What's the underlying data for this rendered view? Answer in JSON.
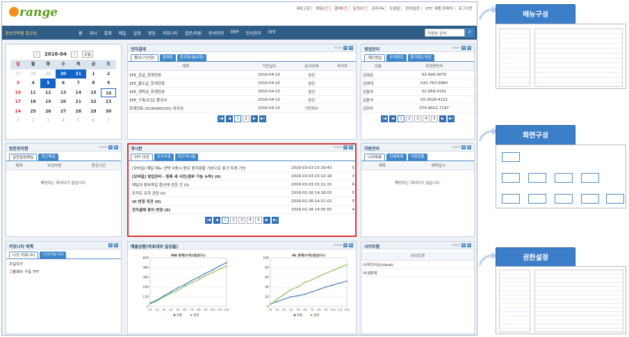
{
  "logo": {
    "text": "range"
  },
  "top_links": [
    {
      "label": "새로고침",
      "badge": ""
    },
    {
      "label": "메일",
      "badge": "0건"
    },
    {
      "label": "결재",
      "badge": "0건"
    },
    {
      "label": "일정",
      "badge": "0건"
    },
    {
      "label": "관리자▾",
      "badge": ""
    },
    {
      "label": "도움말",
      "badge": ""
    },
    {
      "label": "환경설정",
      "badge": ""
    },
    {
      "label": "OTC 제품 판매처",
      "badge": ""
    },
    {
      "label": "로그아웃",
      "badge": ""
    }
  ],
  "nav": {
    "user": "경보전략팀  정규성",
    "items": [
      "홈",
      "게시",
      "결재",
      "메일",
      "일정",
      "영업",
      "커뮤니티",
      "설문/자원",
      "문서관리",
      "ERP",
      "인사관리",
      "SFE"
    ],
    "search_placeholder": "직원명 검색"
  },
  "calendar": {
    "month": "2016-04",
    "today_label": "오늘",
    "days": [
      "일",
      "월",
      "화",
      "수",
      "목",
      "금",
      "토"
    ],
    "rows": [
      [
        "27",
        "28",
        "29",
        "30",
        "31",
        "1",
        "2"
      ],
      [
        "3",
        "4",
        "5",
        "6",
        "7",
        "8",
        "9"
      ],
      [
        "10",
        "11",
        "12",
        "13",
        "14",
        "15",
        "16"
      ],
      [
        "17",
        "18",
        "19",
        "20",
        "21",
        "22",
        "23"
      ],
      [
        "24",
        "25",
        "26",
        "27",
        "28",
        "29",
        "30"
      ],
      [
        "1",
        "2",
        "3",
        "4",
        "5",
        "6",
        "7"
      ]
    ]
  },
  "approval": {
    "title": "전자결재",
    "more": "more",
    "tabs": [
      "품의(기안함)",
      "결재함",
      "참조함(통보함)"
    ],
    "columns": [
      "제목",
      "기안일자",
      "문서상태",
      "처리자"
    ],
    "rows": [
      [
        "SFE_관급_회계전표",
        "2016-04-15",
        "승인",
        ""
      ],
      [
        "SFE_총도급_회계전표",
        "2016-04-15",
        "승인",
        ""
      ],
      [
        "SFE_계약금_회계전표",
        "2016-04-15",
        "승인",
        ""
      ],
      [
        "SFE_구축(도입) 품의서",
        "2016-04-15",
        "승인",
        ""
      ],
      [
        "회계전표-20160401001-정규성",
        "2016-04-15",
        "기안회수",
        ""
      ]
    ],
    "pages": [
      "1",
      "2"
    ]
  },
  "sales": {
    "title": "영업관리",
    "more": "more",
    "tabs": [
      "개인영업",
      "공개영업",
      "즐겨찾는영업"
    ],
    "columns": [
      "이름",
      "주연연락처"
    ],
    "rows": [
      [
        "김영준",
        "02-420-0075"
      ],
      [
        "김영대",
        "031-763-5860"
      ],
      [
        "김향국",
        "02-959-0161"
      ],
      [
        "김윤석",
        "02-2626-4131"
      ],
      [
        "김현아",
        "070-4012-7197"
      ]
    ],
    "pages": [
      "1",
      "2",
      "3",
      "4",
      "5"
    ]
  },
  "visit": {
    "title": "방문관리함",
    "more": "more",
    "tabs": [
      "일정알림메일",
      "최근메일"
    ],
    "columns": [
      "제목",
      "보낸사람",
      "받은시간"
    ],
    "empty": "해당하는 데이터가 없습니다."
  },
  "board": {
    "title": "게시판",
    "more": "more",
    "tabs": [
      "TFT 의견",
      "공지사항",
      "최근게시물"
    ],
    "rows": [
      [
        "[모바일] 메일 메뉴 선택 이동시 받은 편지함을 기본으로 표기 되게 가능",
        "2016-03-03 15:19:43",
        "5"
      ],
      [
        "[모바일] 영업관리 - 등록 세 사전(첨부 기능 누락) (0)",
        "2016-03-03 15:12:18",
        "3"
      ],
      [
        "메일의 첨부파일 옵션에 관한 건 (0)",
        "2016-03-03 15:11:31",
        "6"
      ],
      [
        "조직도 조회 관련 (0)",
        "2016-02-26 14:18:02",
        "5"
      ],
      [
        "UI 변경 의견 (0)",
        "2016-02-26 14:11:02",
        "5"
      ],
      [
        "전자결재 용어 변경 (0)",
        "2016-02-26 14:05:55",
        "4"
      ]
    ],
    "pages": [
      "1",
      "2",
      "3",
      "4",
      "5"
    ]
  },
  "resource": {
    "title": "자원관리",
    "more": "more",
    "tabs": [
      "나의목록",
      "전체목록",
      "자원현황"
    ],
    "columns": [
      "제목",
      "예약일시"
    ],
    "empty": "해당하는 데이터가 없습니다."
  },
  "community": {
    "title": "커뮤니티 목록",
    "more": "more",
    "tabs": [
      "나의 커뮤니티",
      "신규커뮤니티"
    ],
    "items": [
      "주일야구",
      "그룹웨어 구축 TFT"
    ]
  },
  "sales_chart": {
    "title": "매출상황(목표대비 달성율)",
    "more": "more"
  },
  "sites": {
    "title": "사이트맵",
    "more": "more",
    "header": "사이트명",
    "items": [
      "스마트러닝(Ubob)",
      "사내판매"
    ]
  },
  "chart_data": [
    {
      "type": "line",
      "title": "NW 판매(누적)/달성(%)",
      "categories": [
        "1주",
        "2주",
        "3주",
        "4주",
        "5주",
        "6주",
        "7주",
        "8주",
        "9주",
        "10주",
        "11주",
        "12주"
      ],
      "ylim": [
        0,
        600
      ],
      "yticks": [
        0,
        120,
        240,
        360,
        480,
        600
      ],
      "series": [
        {
          "name": "목표",
          "values": [
            40,
            80,
            130,
            180,
            230,
            270,
            320,
            360,
            410,
            450,
            500,
            540
          ],
          "color": "#3a6fb5"
        },
        {
          "name": "실적",
          "values": [
            30,
            70,
            120,
            160,
            200,
            250,
            290,
            330,
            380,
            420,
            460,
            500
          ],
          "color": "#7cc24a"
        }
      ]
    },
    {
      "type": "line",
      "title": "NL 판매(누적)/달성(%)",
      "categories": [
        "1주",
        "2주",
        "3주",
        "4주",
        "5주",
        "6주",
        "7주",
        "8주",
        "9주",
        "10주",
        "11주",
        "12주"
      ],
      "ylim": [
        0,
        100
      ],
      "yticks": [
        0,
        20,
        40,
        60,
        80,
        100
      ],
      "series": [
        {
          "name": "목표",
          "values": [
            5,
            10,
            15,
            20,
            22,
            25,
            30,
            35,
            40,
            44,
            48,
            52
          ],
          "color": "#3a6fb5"
        },
        {
          "name": "실적",
          "values": [
            4,
            15,
            25,
            35,
            40,
            50,
            55,
            62,
            68,
            74,
            80,
            86
          ],
          "color": "#7cc24a"
        }
      ]
    }
  ],
  "labels": {
    "menu": "메뉴구성",
    "screen": "화면구성",
    "perm": "권한설정"
  }
}
